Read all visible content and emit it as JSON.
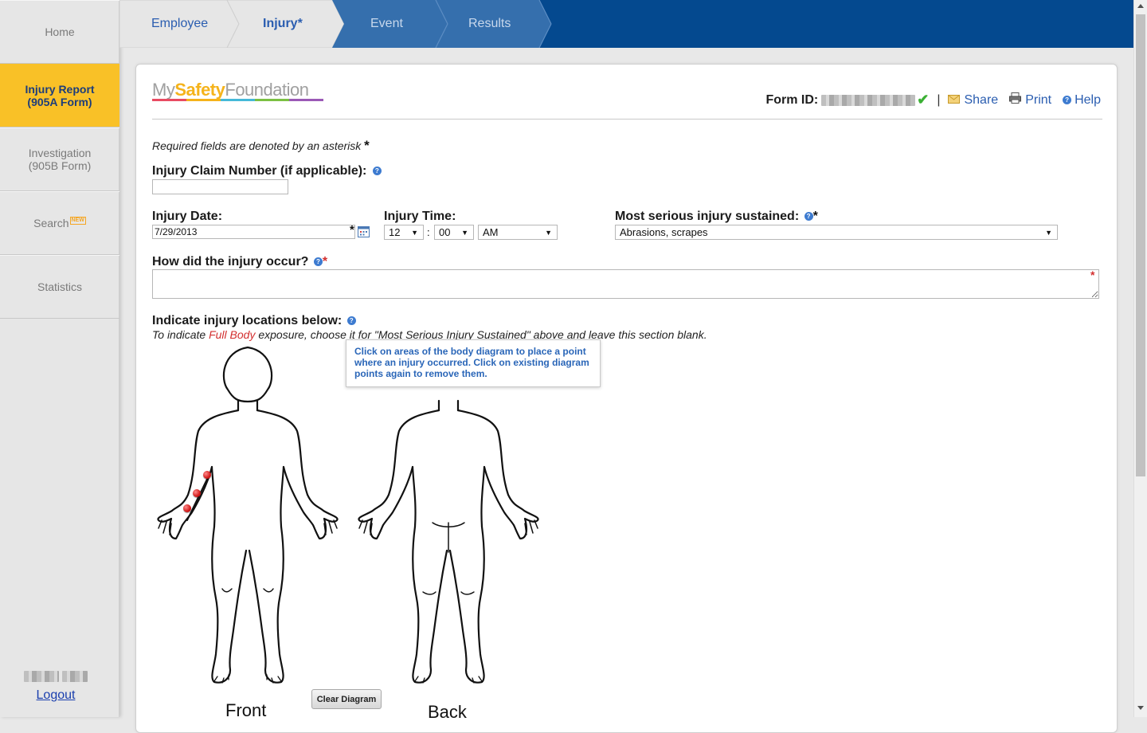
{
  "sidebar": {
    "items": [
      {
        "lines": [
          "Home"
        ]
      },
      {
        "lines": [
          "Injury Report",
          "(905A Form)"
        ]
      },
      {
        "lines": [
          "Investigation",
          "(905B Form)"
        ]
      },
      {
        "lines": [
          "Search"
        ],
        "badge": "NEW"
      },
      {
        "lines": [
          "Statistics"
        ]
      }
    ],
    "logout": "Logout"
  },
  "steps": [
    "Employee",
    "Injury*",
    "Event",
    "Results"
  ],
  "colors": {
    "nav_blue": "#04498f",
    "active_yellow": "#f9c127",
    "link_blue": "#2a5db0",
    "required_red": "#d32f2f"
  },
  "logo": {
    "part1": "My",
    "part2": "Safety",
    "part3": "Foundation"
  },
  "header": {
    "form_id_label": "Form ID:",
    "share": "Share",
    "print": "Print",
    "help": "Help",
    "share_icon": "envelope-icon",
    "print_icon": "printer-icon",
    "help_icon": "help-icon"
  },
  "form": {
    "required_note": "Required fields are denoted by an asterisk",
    "claim_label": "Injury Claim Number (if applicable):",
    "claim_value": "",
    "date_label": "Injury Date:",
    "date_value": "7/29/2013",
    "time_label": "Injury Time:",
    "hour": "12",
    "minute": "00",
    "ampm": "AM",
    "injury_label": "Most serious injury sustained:",
    "injury_value": "Abrasions, scrapes",
    "occur_label": "How did the injury occur?",
    "locations_label": "Indicate injury locations below:",
    "full_body_pre": "To indicate ",
    "full_body_hl": "Full Body",
    "full_body_post": " exposure, choose it for \"Most Serious Injury Sustained\" above and leave this section blank.",
    "tooltip": "Click on areas of the body diagram to place a point where an injury occurred. Click on existing diagram points again to remove them.",
    "clear_button": "Clear Diagram",
    "front_label": "Front",
    "back_label": "Back"
  }
}
